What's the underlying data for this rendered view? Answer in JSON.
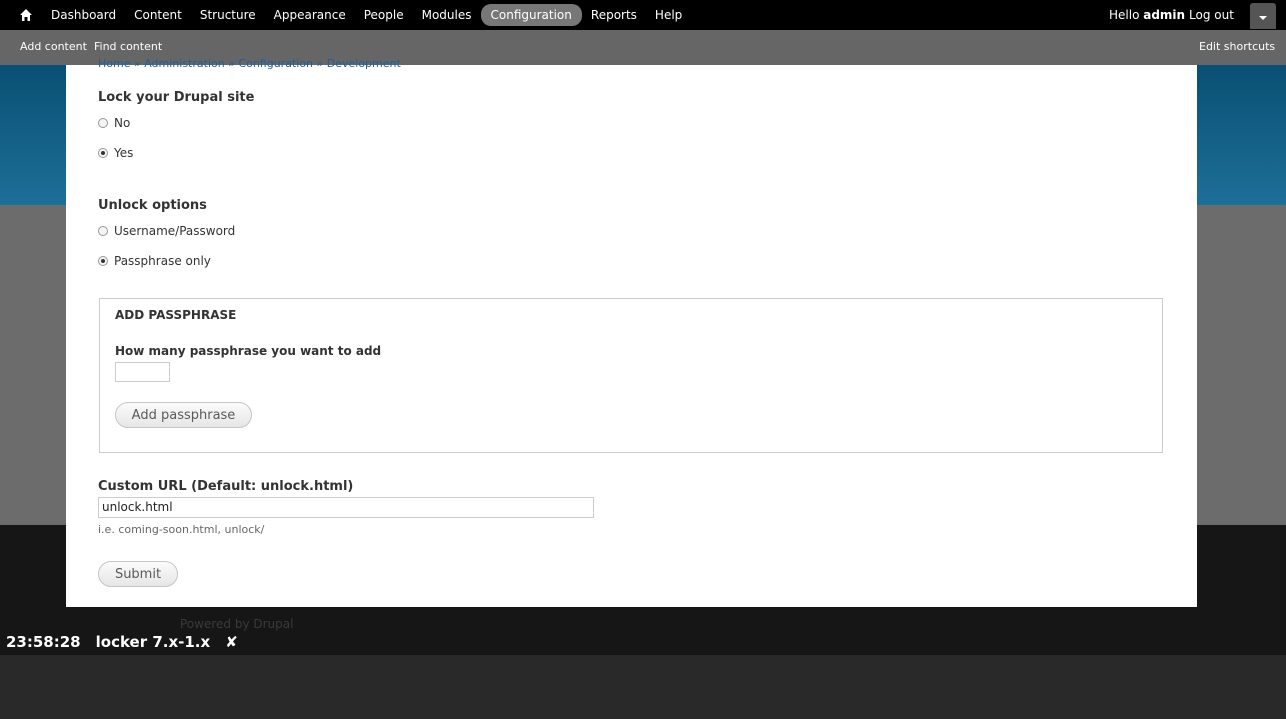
{
  "toolbar": {
    "menu": [
      "Dashboard",
      "Content",
      "Structure",
      "Appearance",
      "People",
      "Modules",
      "Configuration",
      "Reports",
      "Help"
    ],
    "active": "Configuration",
    "hello_prefix": "Hello ",
    "username": "admin",
    "logout": "Log out"
  },
  "shortcuts": {
    "add_content": "Add content",
    "find_content": "Find content",
    "edit_shortcuts": "Edit shortcuts"
  },
  "breadcrumb": "Home » Administration » Configuration » Development",
  "lock": {
    "label": "Lock your Drupal site",
    "options": [
      "No",
      "Yes"
    ],
    "selected": "Yes"
  },
  "unlock": {
    "label": "Unlock options",
    "options": [
      "Username/Password",
      "Passphrase only"
    ],
    "selected": "Passphrase only"
  },
  "add_passphrase": {
    "legend": "ADD PASSPHRASE",
    "field_label": "How many passphrase you want to add",
    "field_value": "",
    "button": "Add passphrase"
  },
  "custom_url": {
    "label": "Custom URL (Default: unlock.html)",
    "value": "unlock.html",
    "description": "i.e. coming-soon.html, unlock/"
  },
  "submit": "Submit",
  "footer": {
    "powered": "Powered by Drupal"
  },
  "statusbar": {
    "time": "23:58:28",
    "project": "locker 7.x-1.x",
    "close": "✘"
  }
}
